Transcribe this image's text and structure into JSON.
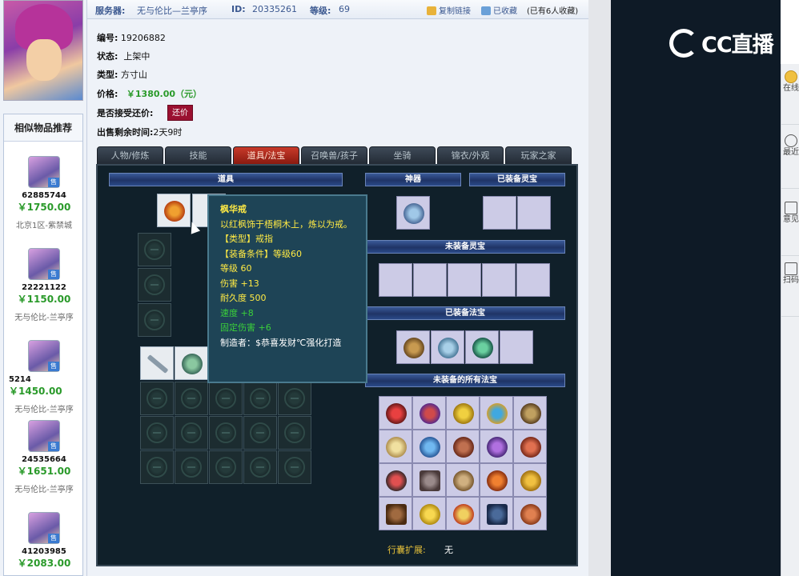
{
  "top": {
    "server_label": "服务器:",
    "server_value": "无与伦比—兰亭序",
    "id_label": "ID:",
    "id_value": "20335261",
    "level_label": "等级:",
    "level_value": "69",
    "copy_link": "复制链接",
    "collected": "已收藏",
    "collect_count": "(已有6人收藏)"
  },
  "item_info": {
    "number_label": "编号:",
    "number_value": "19206882",
    "status_label": "状态:",
    "status_value": "上架中",
    "type_label": "类型:",
    "type_value": "方寸山",
    "price_label": "价格:",
    "price_value": "￥1380.00（元）",
    "counter_label": "是否接受还价:",
    "counter_button": "还价",
    "remaining_label": "出售剩余时间:",
    "remaining_value": "2天9时"
  },
  "similar": {
    "title": "相似物品推荐",
    "tag": "售",
    "items": [
      {
        "id": "62885744",
        "price": "￥1750.00",
        "server": "北京1区-紫禁城"
      },
      {
        "id": "22221122",
        "price": "￥1150.00",
        "server": "无与伦比-兰亭序"
      },
      {
        "id": "5214",
        "price": "￥1450.00",
        "server": "无与伦比-兰亭序"
      },
      {
        "id": "24535664",
        "price": "￥1651.00",
        "server": "无与伦比-兰亭序"
      },
      {
        "id": "41203985",
        "price": "￥2083.00",
        "server": ""
      }
    ]
  },
  "tabs": [
    "人物/修炼",
    "技能",
    "道具/法宝",
    "召唤兽/孩子",
    "坐骑",
    "锦衣/外观",
    "玩家之家"
  ],
  "panel": {
    "items_header": "道具",
    "artifact_header": "神器",
    "equipped_lingbao": "已装备灵宝",
    "unequipped_lingbao": "未装备灵宝",
    "equipped_fabao": "已装备法宝",
    "all_unequipped_fabao": "未装备的所有法宝",
    "expand_label": "行囊扩展:",
    "expand_value": "无"
  },
  "tooltip": {
    "name": "枫华戒",
    "desc": "以红枫饰于梧桐木上，炼以为戒。",
    "type": "【类型】戒指",
    "req": "【装备条件】等级60",
    "level": "等级 60",
    "damage": "伤害 +13",
    "durability": "耐久度 500",
    "speed": "速度 +8",
    "fixed_damage": "固定伤害 +6",
    "maker": "制造者：$恭喜发财℃强化打造"
  },
  "stream": {
    "logo_text": "CC直播",
    "rail": [
      "在线精灵",
      "最近浏览",
      "意见反馈",
      "扫码下载"
    ]
  },
  "colors": {
    "accent_blue": "#3b5890",
    "price_green": "#2a9a2a",
    "tab_active": "#c83a2a",
    "tooltip_yellow": "#ffea44",
    "tooltip_green": "#3ad03a"
  }
}
